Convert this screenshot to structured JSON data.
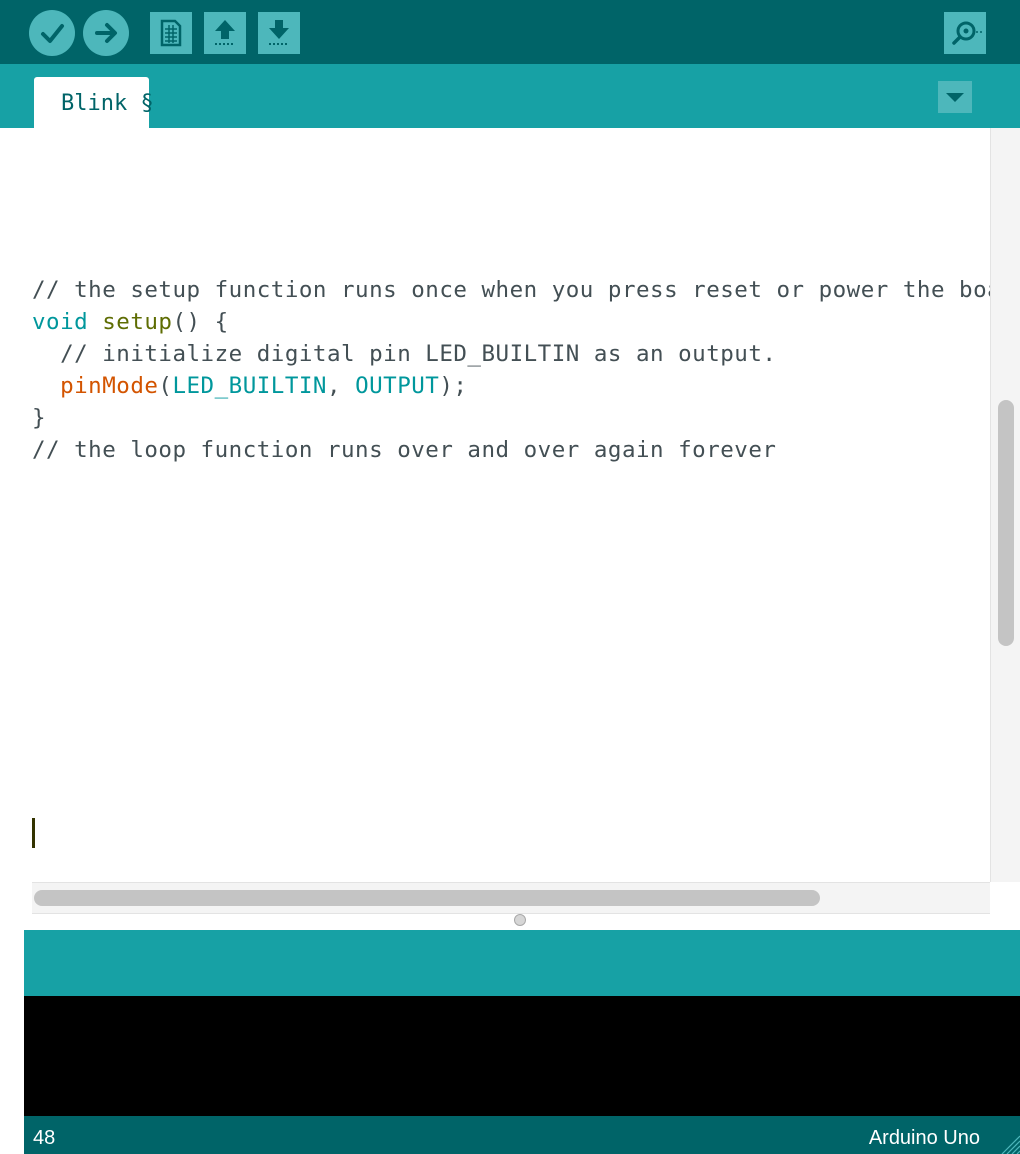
{
  "toolbar": {
    "buttons": [
      {
        "name": "verify",
        "icon": "check-icon"
      },
      {
        "name": "upload",
        "icon": "arrow-right-icon"
      },
      {
        "name": "new",
        "icon": "new-file-icon"
      },
      {
        "name": "open",
        "icon": "arrow-up-icon"
      },
      {
        "name": "save",
        "icon": "arrow-down-icon"
      },
      {
        "name": "serial-monitor",
        "icon": "magnifier-icon"
      }
    ]
  },
  "tabs": [
    {
      "label": "Blink §",
      "active": true
    }
  ],
  "editor": {
    "lines": [
      {
        "comment": "// the setup function runs once when you press reset or power the boa"
      },
      {
        "kw": "void",
        "sp": " ",
        "fn": "setup",
        "rest": "() {"
      },
      {
        "comment": "  // initialize digital pin LED_BUILTIN as an output."
      },
      {
        "indent": "  ",
        "fn2": "pinMode",
        "p1": "(",
        "c1": "LED_BUILTIN",
        "p2": ", ",
        "c2": "OUTPUT",
        "p3": ");"
      },
      {
        "plain": "}"
      },
      {
        "comment": "// the loop function runs over and over again forever"
      }
    ]
  },
  "status": {
    "line": "48",
    "board": "Arduino Uno"
  },
  "colors": {
    "toolbar_bg": "#006468",
    "tab_bar_bg": "#17a1a5",
    "button_bg": "#4db7bb",
    "keyword": "#00979c",
    "function": "#5e6d03",
    "builtin_function": "#d35400"
  }
}
